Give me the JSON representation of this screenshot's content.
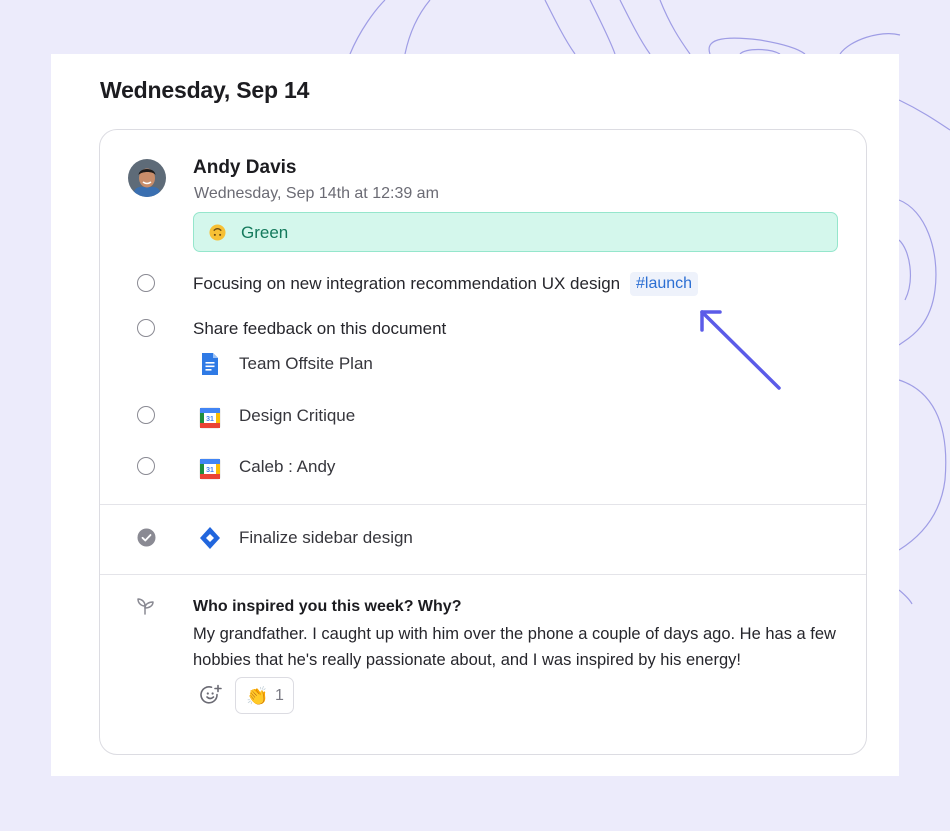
{
  "date_heading": "Wednesday, Sep 14",
  "checkin": {
    "user_name": "Andy Davis",
    "timestamp": "Wednesday, Sep 14th at 12:39 am",
    "mood": {
      "emoji": "upside-down-face-icon",
      "label": "Green",
      "color": "#147a5c"
    }
  },
  "tasks": [
    {
      "text": "Focusing on new integration recommendation UX design",
      "tag": "#launch",
      "done": false
    },
    {
      "text": "Share feedback on this document",
      "done": false,
      "attachment": {
        "icon": "google-docs-icon",
        "title": "Team Offsite Plan"
      }
    },
    {
      "icon": "google-calendar-icon",
      "title": "Design Critique",
      "done": false
    },
    {
      "icon": "google-calendar-icon",
      "title": "Caleb : Andy",
      "done": false
    }
  ],
  "completed": [
    {
      "icon": "jira-icon",
      "title": "Finalize sidebar design",
      "done": true
    }
  ],
  "prompt": {
    "question": "Who inspired you this week? Why?",
    "answer": "My grandfather. I caught up with him over the phone a couple of days ago. He has a few hobbies that he's really passionate about, and I was inspired by his energy!"
  },
  "reactions": [
    {
      "emoji": "👏",
      "count": "1"
    }
  ],
  "colors": {
    "accent": "#5b5be8",
    "tag": "#2c6fd3",
    "background": "#ecebfb"
  }
}
